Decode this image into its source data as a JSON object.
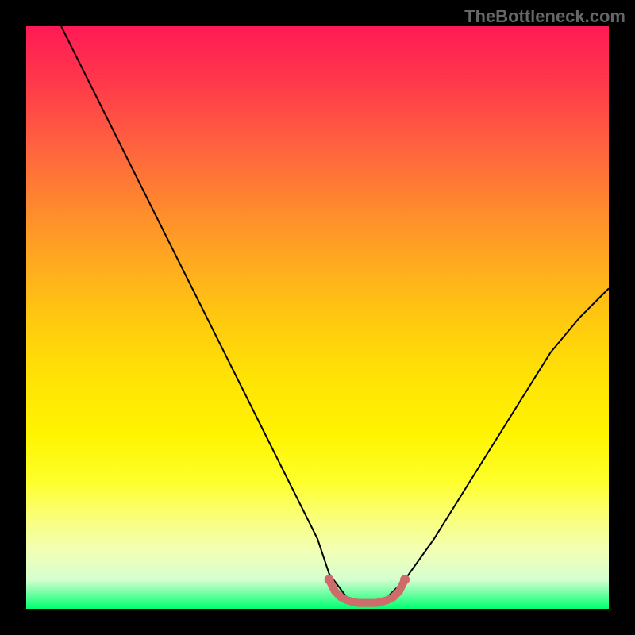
{
  "watermark": "TheBottleneck.com",
  "chart_data": {
    "type": "line",
    "title": "",
    "xlabel": "",
    "ylabel": "",
    "xlim": [
      0,
      100
    ],
    "ylim": [
      0,
      100
    ],
    "series": [
      {
        "name": "bottleneck-curve",
        "x": [
          6,
          10,
          15,
          20,
          25,
          30,
          35,
          40,
          45,
          50,
          52,
          55,
          58,
          60,
          62,
          65,
          70,
          75,
          80,
          85,
          90,
          95,
          100
        ],
        "y": [
          100,
          92,
          82,
          72,
          62,
          52,
          42,
          32,
          22,
          12,
          6,
          2,
          1,
          1,
          2,
          5,
          12,
          20,
          28,
          36,
          44,
          50,
          55
        ]
      },
      {
        "name": "optimal-range-marker",
        "x": [
          52,
          53,
          54,
          55,
          56,
          57,
          58,
          59,
          60,
          61,
          62,
          63,
          64,
          65
        ],
        "y": [
          5,
          3,
          2,
          1.5,
          1.2,
          1,
          1,
          1,
          1,
          1.2,
          1.5,
          2,
          3,
          5
        ]
      }
    ],
    "colors": {
      "curve": "#000000",
      "marker": "#d06b6b",
      "gradient_top": "#ff1a55",
      "gradient_bottom": "#00ff70"
    }
  }
}
